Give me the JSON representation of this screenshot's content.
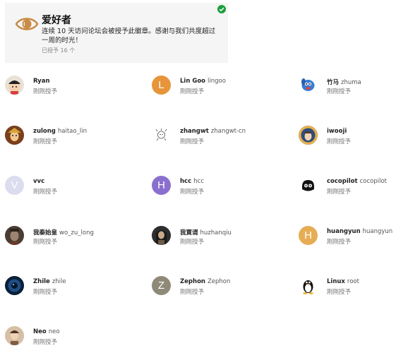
{
  "badge": {
    "title": "爱好者",
    "description": "连续 10 天访问论坛会被授予此徽章。感谢与我们共度超过一周的时光！",
    "granted_count": "已授予 16 个",
    "icon": "eye-icon",
    "icon_color": "#c98a44",
    "check_color": "#1f9d3f"
  },
  "users": [
    {
      "name": "Ryan",
      "username": "",
      "granted": "刚刚授予",
      "avatar": "image",
      "avatar_icon": "cartoon-boy-avatar"
    },
    {
      "name": "Lin Goo",
      "username": "lingoo",
      "granted": "刚刚授予",
      "avatar": "letter",
      "letter": "L",
      "color": "#e7943a"
    },
    {
      "name": "竹马",
      "username": "zhuma",
      "granted": "刚刚授予",
      "avatar": "image",
      "avatar_icon": "blue-dog-avatar"
    },
    {
      "name": "zulong",
      "username": "haitao_lin",
      "granted": "刚刚授予",
      "avatar": "image",
      "avatar_icon": "ornate-face-avatar"
    },
    {
      "name": "zhangwt",
      "username": "zhangwt-cn",
      "granted": "刚刚授予",
      "avatar": "image",
      "avatar_icon": "sketch-avatar"
    },
    {
      "name": "iwooji",
      "username": "",
      "granted": "刚刚授予",
      "avatar": "image",
      "avatar_icon": "anime-avatar"
    },
    {
      "name": "vvc",
      "username": "",
      "granted": "刚刚授予",
      "avatar": "letter",
      "letter": "V",
      "color": "#dcdcef"
    },
    {
      "name": "hcc",
      "username": "hcc",
      "granted": "刚刚授予",
      "avatar": "letter",
      "letter": "H",
      "color": "#8a6fcf"
    },
    {
      "name": "cocopilot",
      "username": "cocopilot",
      "granted": "刚刚授予",
      "avatar": "image",
      "avatar_icon": "copilot-avatar"
    },
    {
      "name": "我秦始皇",
      "username": "wo_zu_long",
      "granted": "刚刚授予",
      "avatar": "image",
      "avatar_icon": "statue-avatar"
    },
    {
      "name": "我賈谞",
      "username": "huzhanqiu",
      "granted": "刚刚授予",
      "avatar": "image",
      "avatar_icon": "warrior-avatar"
    },
    {
      "name": "huangyun",
      "username": "huangyun",
      "granted": "刚刚授予",
      "avatar": "letter",
      "letter": "H",
      "color": "#e6ad55"
    },
    {
      "name": "Zhile",
      "username": "zhile",
      "granted": "刚刚授予",
      "avatar": "image",
      "avatar_icon": "dark-blue-avatar"
    },
    {
      "name": "Zephon",
      "username": "Zephon",
      "granted": "刚刚授予",
      "avatar": "letter",
      "letter": "Z",
      "color": "#8f8a77"
    },
    {
      "name": "Linux",
      "username": "root",
      "granted": "刚刚授予",
      "avatar": "image",
      "avatar_icon": "tux-avatar"
    },
    {
      "name": "Neo",
      "username": "neo",
      "granted": "刚刚授予",
      "avatar": "image",
      "avatar_icon": "portrait-avatar"
    }
  ]
}
